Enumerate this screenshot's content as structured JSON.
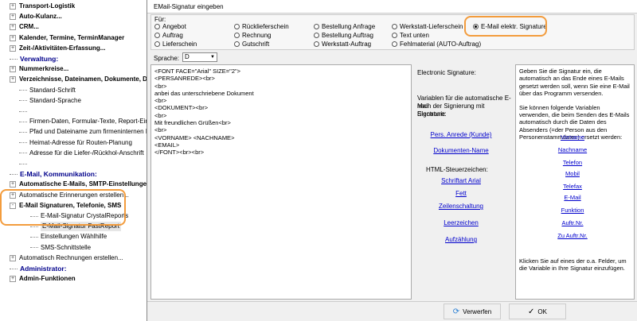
{
  "tree": {
    "items": [
      {
        "label": "Transport-Logistik",
        "style": "bold",
        "level": 1,
        "expander": "+"
      },
      {
        "label": "Auto-Kulanz...",
        "style": "bold",
        "level": 1,
        "expander": "+"
      },
      {
        "label": "CRM...",
        "style": "bold",
        "level": 1,
        "expander": "+"
      },
      {
        "label": "Kalender, Termine, TerminManager",
        "style": "bold",
        "level": 1,
        "expander": "+"
      },
      {
        "label": "Zeit-/Aktivitäten-Erfassung...",
        "style": "bold",
        "level": 1,
        "expander": "+"
      },
      {
        "label": "Verwaltung:",
        "style": "head",
        "level": 1,
        "expander": ""
      },
      {
        "label": "Nummerkreise...",
        "style": "bold",
        "level": 1,
        "expander": "+"
      },
      {
        "label": "Verzeichnisse, Dateinamen, Dokumente, D",
        "style": "bold",
        "level": 1,
        "expander": "+"
      },
      {
        "label": "Standard-Schrift",
        "style": "",
        "level": 2,
        "expander": ""
      },
      {
        "label": "Standard-Sprache",
        "style": "",
        "level": 2,
        "expander": ""
      },
      {
        "label": "",
        "style": "",
        "level": 2,
        "expander": ""
      },
      {
        "label": "Firmen-Daten, Formular-Texte, Report-Einste",
        "style": "",
        "level": 2,
        "expander": ""
      },
      {
        "label": "Pfad und Dateiname zum firmeninternen Betri",
        "style": "",
        "level": 2,
        "expander": ""
      },
      {
        "label": "Heimat-Adresse für Routen-Planung",
        "style": "",
        "level": 2,
        "expander": ""
      },
      {
        "label": "Adresse für die Liefer-/Rückhol-Anschrift",
        "style": "",
        "level": 2,
        "expander": ""
      },
      {
        "label": "",
        "style": "",
        "level": 2,
        "expander": ""
      },
      {
        "label": "E-Mail, Kommunikation:",
        "style": "head",
        "level": 1,
        "expander": ""
      },
      {
        "label": "Automatische E-Mails, SMTP-Einstellunger",
        "style": "bold",
        "level": 1,
        "expander": "+"
      },
      {
        "label": "Automatische Erinnerungen erstellen...",
        "style": "",
        "level": 1,
        "expander": "+"
      },
      {
        "label": "E-Mail Signaturen, Telefonie, SMS",
        "style": "bold",
        "level": 1,
        "expander": "-"
      },
      {
        "label": "E-Mail-Signatur CrystalReports",
        "style": "",
        "level": 3,
        "expander": ""
      },
      {
        "label": "E-Mail-Signatur FastReport",
        "style": "selected",
        "level": 3,
        "expander": ""
      },
      {
        "label": "Einstellungen Wählhilfe",
        "style": "",
        "level": 3,
        "expander": ""
      },
      {
        "label": "SMS-Schnittstelle",
        "style": "",
        "level": 3,
        "expander": ""
      },
      {
        "label": "Automatisch Rechnungen erstellen...",
        "style": "",
        "level": 1,
        "expander": "+"
      },
      {
        "label": "Administrator:",
        "style": "head",
        "level": 1,
        "expander": ""
      },
      {
        "label": "Admin-Funktionen",
        "style": "bold",
        "level": 1,
        "expander": "+"
      }
    ]
  },
  "dialog": {
    "title": "EMail-Signatur eingeben",
    "fuer_label": "Für:",
    "radios": [
      {
        "label": "Angebot",
        "checked": false
      },
      {
        "label": "Rücklieferschein",
        "checked": false
      },
      {
        "label": "Bestellung Anfrage",
        "checked": false
      },
      {
        "label": "Werkstatt-Lieferschein",
        "checked": false
      },
      {
        "label": "E-Mail elektr. Signature",
        "checked": true
      },
      {
        "label": "Auftrag",
        "checked": false
      },
      {
        "label": "Rechnung",
        "checked": false
      },
      {
        "label": "Bestellung Auftrag",
        "checked": false
      },
      {
        "label": "Text unten",
        "checked": false
      },
      {
        "label": "Lieferschein",
        "checked": false
      },
      {
        "label": "Gutschrift",
        "checked": false
      },
      {
        "label": "Werkstatt-Auftrag",
        "checked": false
      },
      {
        "label": "Fehlmaterial (AUTO-Auftrag)",
        "checked": false
      }
    ],
    "sprache_label": "Sprache:",
    "sprache_value": "D",
    "editor_lines": [
      "<FONT FACE=\"Arial\" SIZE=\"2\">",
      "<PERSANREDE><br>",
      "<br>",
      "anbei das unterschriebene Dokument",
      "<br>",
      "<DOKUMENT><br>",
      "<br>",
      "Mit freundlichen Grüßen<br>",
      "<br>",
      "<VORNAME> <NACHNAME>",
      "<EMAIL>",
      "</FONT><br><br>"
    ],
    "vars": {
      "title": "Electronic Signature:",
      "desc": [
        "Variablen für die automatische E-Mail",
        "nach der Signierung mit Electronic",
        "Signature:"
      ],
      "links1": [
        "Pers. Anrede (Kunde)",
        "Dokumenten-Name"
      ],
      "html_label": "HTML-Steuerzeichen:",
      "links2": [
        "Schriftart Arial",
        "Fett",
        "Zeilenschaltung",
        "Leerzeichen",
        "Aufzählung"
      ]
    },
    "help": {
      "p1": "Geben Sie die Signatur ein, die automatisch an das Ende eines E-Mails gesetzt werden soll, wenn Sie eine E-Mail über das Programm versenden.",
      "p2": "Sie können folgende Variablen verwenden, die beim Senden des E-Mails automatisch durch die Daten des Absenders (=der Person aus den Personenstammdaten) ersetzt werden:",
      "links": [
        "Vorname",
        "Nachname",
        "Telefon",
        "Mobil",
        "Telefax",
        "E-Mail",
        "Funktion",
        "Auftr.Nr.",
        "Zu Auftr.Nr."
      ],
      "p3": "Klicken Sie auf eines der o.a. Felder, um die Variable in Ihre Signatur einzufügen."
    },
    "buttons": {
      "discard": "Verwerfen",
      "ok": "OK"
    }
  }
}
